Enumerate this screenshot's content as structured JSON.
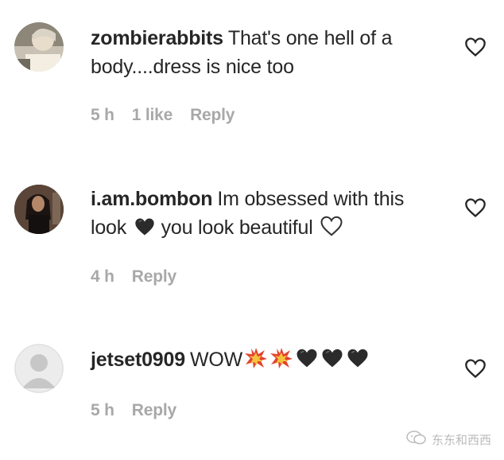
{
  "comments": [
    {
      "username": "zombierabbits",
      "text_line1": "That's one hell of a",
      "text_line2": "body....dress is nice too",
      "time": "5 h",
      "likes": "1 like",
      "reply_label": "Reply"
    },
    {
      "username": "i.am.bombon",
      "text_line1": "Im obsessed with this",
      "text_line2_a": "look",
      "text_line2_b": "you look beautiful",
      "time": "4 h",
      "reply_label": "Reply"
    },
    {
      "username": "jetset0909",
      "text": "WOW",
      "time": "5 h",
      "reply_label": "Reply"
    }
  ],
  "watermark": {
    "text": "东东和西西",
    "icon": "wechat-icon"
  },
  "icons": {
    "like": "heart-outline-icon",
    "black_heart": "black-heart-emoji",
    "white_heart": "white-heart-emoji",
    "collision": "collision-emoji"
  }
}
